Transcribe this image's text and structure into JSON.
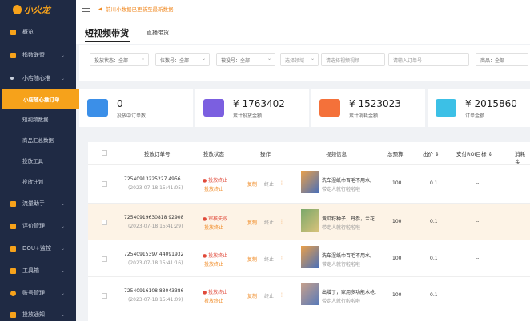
{
  "app": {
    "logo_text": "小火龙"
  },
  "sidebar": {
    "items": [
      {
        "label": "概览",
        "chevron": ""
      },
      {
        "label": "指数联盟",
        "chevron": "⌄"
      },
      {
        "label": "小店随心推",
        "chevron": "⌄"
      },
      {
        "label": "流量助手",
        "chevron": "⌄"
      },
      {
        "label": "评价管理",
        "chevron": "⌄"
      },
      {
        "label": "DOU+监控",
        "chevron": "⌄"
      },
      {
        "label": "工具箱",
        "chevron": "⌄"
      },
      {
        "label": "账号管理",
        "chevron": "⌄"
      },
      {
        "label": "投放通知",
        "chevron": "⌄"
      }
    ],
    "sub_items": [
      "小店随心推订单",
      "短视频数据",
      "商品汇总数据",
      "投放工具",
      "投放计划"
    ]
  },
  "topbar": {
    "notice": "前川小数据已更新至最新数据"
  },
  "tabs": {
    "main": "短视频带货",
    "secondary": "直播带货"
  },
  "filters": [
    {
      "text": "投放状态：全部"
    },
    {
      "text": "位数号：全部"
    },
    {
      "text": "被投号：全部"
    },
    {
      "text": "选择领域"
    },
    {
      "text": "请选择视频视频"
    },
    {
      "text": "请输入订单号"
    },
    {
      "text": "商品：全部"
    }
  ],
  "stats": [
    {
      "value": "0",
      "label": "投放中订单数",
      "color": "#3b8fe8"
    },
    {
      "value": "¥ 1763402",
      "label": "累计投放金额",
      "color": "#7b5fe0"
    },
    {
      "value": "¥ 1523023",
      "label": "累计消耗金额",
      "color": "#f4713a"
    },
    {
      "value": "¥ 2015860",
      "label": "订单金额",
      "color": "#3cc0e6"
    }
  ],
  "table": {
    "headers": [
      "投放订单号",
      "投放状态",
      "操作",
      "视频信息",
      "总预算",
      "出价 ⇕",
      "支付ROI目标 ⇕",
      "消耗金"
    ],
    "rows": [
      {
        "order": "72540913225227 4956",
        "time": "(2023-07-18 15:41:05)",
        "status": "投放终止",
        "sub": "投放终止",
        "ops": [
          "复制",
          "终止",
          "⋮"
        ],
        "video": "洗车湿纸巾百毛不用水,",
        "video2": "带走人就行啦啦啦",
        "budget": "100",
        "bid": "0.1",
        "roi": "--",
        "highlight": false
      },
      {
        "order": "72540919630818 92908",
        "time": "(2023-07-18 15:41:29)",
        "status": "审核失败",
        "sub": "投放终止",
        "ops": [
          "复制",
          "终止",
          "⋮"
        ],
        "video": "黄瓜籽种子，丹参，兰花,",
        "video2": "带走人就行啦啦啦",
        "budget": "100",
        "bid": "0.1",
        "roi": "--",
        "highlight": true
      },
      {
        "order": "72540915397 44091932",
        "time": "(2023-07-18 15:41:16)",
        "status": "投放终止",
        "sub": "投放终止",
        "ops": [
          "复制",
          "终止",
          "⋮"
        ],
        "video": "洗车湿纸巾百毛不用水,",
        "video2": "带走人就行啦啦啦",
        "budget": "100",
        "bid": "0.1",
        "roi": "--",
        "highlight": false
      },
      {
        "order": "72540916108 83043386",
        "time": "(2023-07-18 15:41:09)",
        "status": "投放终止",
        "sub": "投放终止",
        "ops": [
          "复制",
          "终止",
          "⋮"
        ],
        "video": "出增了，家用多功能水枪,",
        "video2": "带走人就行啦啦啦",
        "budget": "100",
        "bid": "0.1",
        "roi": "--",
        "highlight": false
      }
    ]
  }
}
